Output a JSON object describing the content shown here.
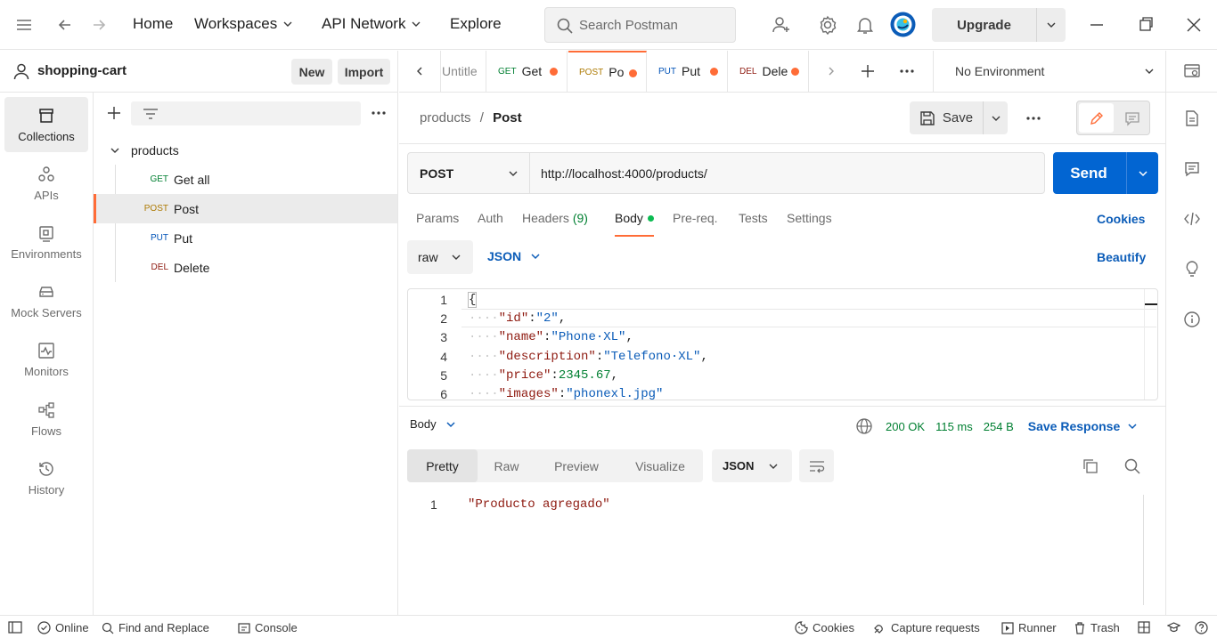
{
  "topbar": {
    "nav": [
      "Home",
      "Workspaces",
      "API Network",
      "Explore"
    ],
    "search_placeholder": "Search Postman",
    "upgrade_label": "Upgrade"
  },
  "workspace": {
    "name": "shopping-cart",
    "new_label": "New",
    "import_label": "Import"
  },
  "sidebar": {
    "items": [
      {
        "label": "Collections",
        "icon": "collections-icon"
      },
      {
        "label": "APIs",
        "icon": "apis-icon"
      },
      {
        "label": "Environments",
        "icon": "environments-icon"
      },
      {
        "label": "Mock Servers",
        "icon": "mock-servers-icon"
      },
      {
        "label": "Monitors",
        "icon": "monitors-icon"
      },
      {
        "label": "Flows",
        "icon": "flows-icon"
      },
      {
        "label": "History",
        "icon": "history-icon"
      }
    ]
  },
  "collection": {
    "folder": "products",
    "requests": [
      {
        "method": "GET",
        "name": "Get all"
      },
      {
        "method": "POST",
        "name": "Post"
      },
      {
        "method": "PUT",
        "name": "Put"
      },
      {
        "method": "DEL",
        "name": "Delete"
      }
    ]
  },
  "tabs": [
    {
      "method": "",
      "name": "Untitle"
    },
    {
      "method": "GET",
      "name": "Get"
    },
    {
      "method": "POST",
      "name": "Po"
    },
    {
      "method": "PUT",
      "name": "Put"
    },
    {
      "method": "DEL",
      "name": "Dele"
    }
  ],
  "environment": "No Environment",
  "request": {
    "breadcrumb_parent": "products",
    "breadcrumb_sep": "/",
    "breadcrumb_current": "Post",
    "save_label": "Save",
    "method": "POST",
    "url": "http://localhost:4000/products/",
    "send_label": "Send",
    "tabs": [
      "Params",
      "Auth",
      "Headers",
      "Body",
      "Pre-req.",
      "Tests",
      "Settings"
    ],
    "headers_count": "(9)",
    "cookies_label": "Cookies",
    "body_mode": "raw",
    "body_format": "JSON",
    "beautify_label": "Beautify",
    "body_lines": [
      "1",
      "2",
      "3",
      "4",
      "5",
      "6"
    ]
  },
  "body_code": {
    "l1": "{",
    "k_id": "\"id\"",
    "v_id": "\"2\"",
    "k_name": "\"name\"",
    "v_name": "\"Phone·XL\"",
    "k_desc": "\"description\"",
    "v_desc": "\"Telefono·XL\"",
    "k_price": "\"price\"",
    "v_price": "2345.67",
    "k_images": "\"images\"",
    "v_images": "\"phonexl.jpg\""
  },
  "response": {
    "body_label": "Body",
    "status": "200 OK",
    "time": "115 ms",
    "size": "254 B",
    "save_label": "Save Response",
    "view_tabs": [
      "Pretty",
      "Raw",
      "Preview",
      "Visualize"
    ],
    "format": "JSON",
    "line": "1",
    "text": "\"Producto agregado\""
  },
  "statusbar": {
    "online": "Online",
    "find_replace": "Find and Replace",
    "console": "Console",
    "cookies": "Cookies",
    "capture": "Capture requests",
    "runner": "Runner",
    "trash": "Trash"
  },
  "colors": {
    "accent": "#ff6c37",
    "send_blue": "#0265d2",
    "link_blue": "#0b5cb8",
    "status_green": "#007f31"
  }
}
